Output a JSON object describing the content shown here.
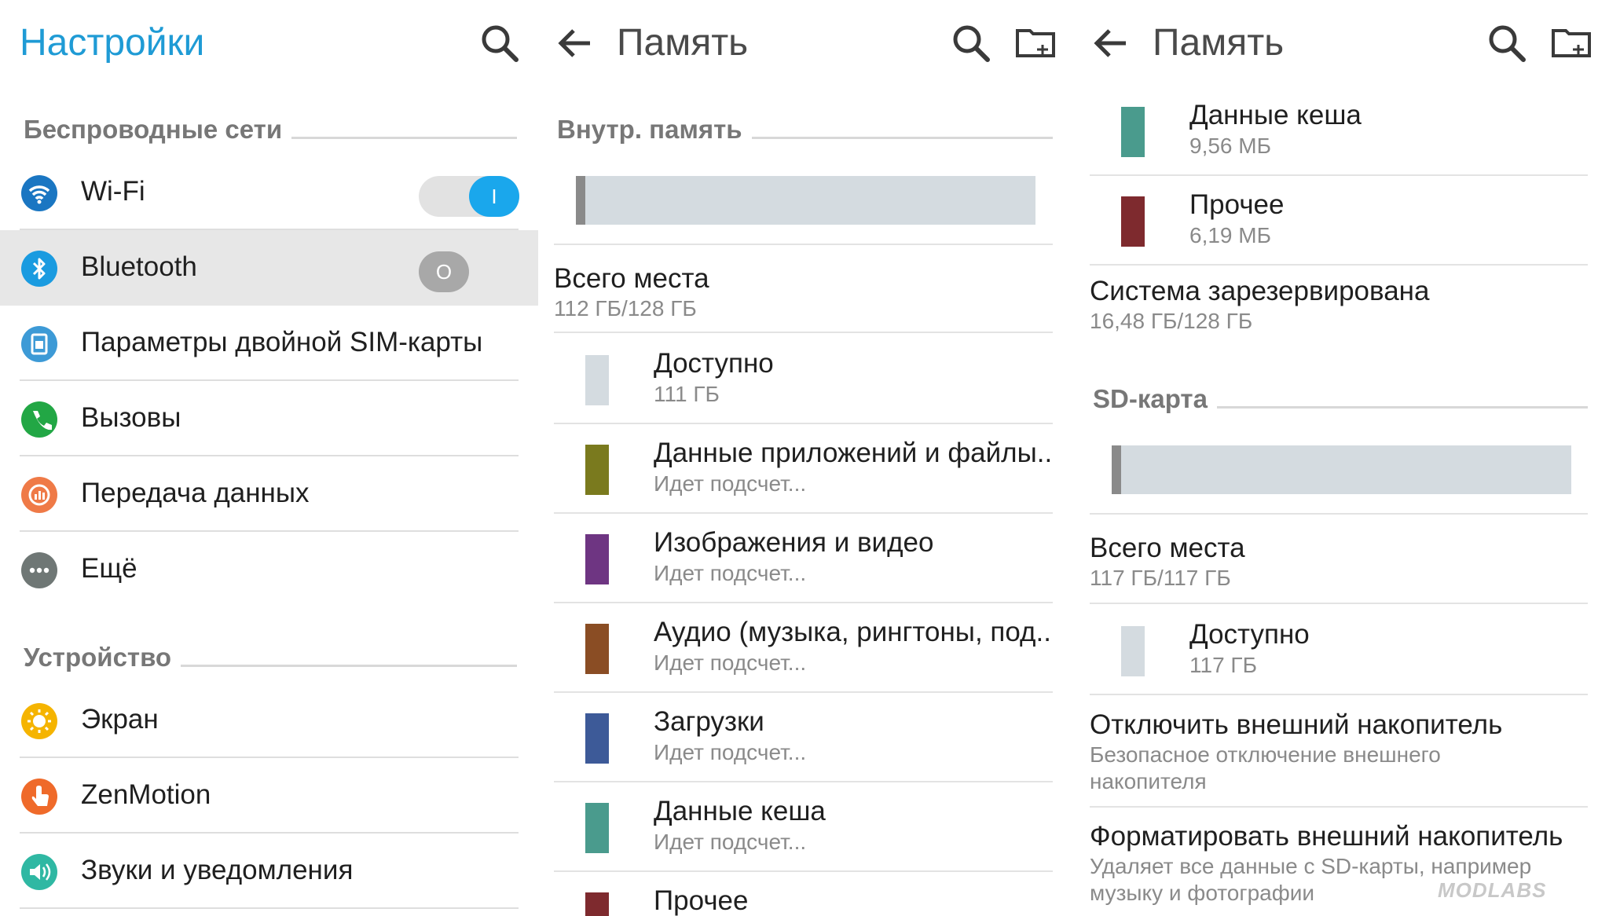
{
  "settings": {
    "title": "Настройки",
    "wireless_header": "Беспроводные сети",
    "wifi": {
      "label": "Wi-Fi",
      "toggle": "I"
    },
    "bluetooth": {
      "label": "Bluetooth",
      "toggle": "O"
    },
    "dualsim": {
      "label": "Параметры двойной SIM-карты"
    },
    "calls": {
      "label": "Вызовы"
    },
    "data": {
      "label": "Передача данных"
    },
    "more": {
      "label": "Ещё"
    },
    "device_header": "Устройство",
    "screen": {
      "label": "Экран"
    },
    "zenmotion": {
      "label": "ZenMotion"
    },
    "sounds": {
      "label": "Звуки и уведомления"
    }
  },
  "memory_internal": {
    "title": "Память",
    "section": "Внутр. память",
    "total": {
      "label": "Всего места",
      "value": "112 ГБ/128 ГБ"
    },
    "items": [
      {
        "label": "Доступно",
        "value": "111 ГБ",
        "color": "#d4dbe0"
      },
      {
        "label": "Данные приложений и файлы..",
        "value": "Идет подсчет...",
        "color": "#7a7a1e"
      },
      {
        "label": "Изображения и видео",
        "value": "Идет подсчет...",
        "color": "#6e3582"
      },
      {
        "label": "Аудио (музыка, рингтоны, под..",
        "value": "Идет подсчет...",
        "color": "#8a4d24"
      },
      {
        "label": "Загрузки",
        "value": "Идет подсчет...",
        "color": "#3d5a98"
      },
      {
        "label": "Данные кеша",
        "value": "Идет подсчет...",
        "color": "#4a9b8d"
      },
      {
        "label": "Прочее",
        "value": "",
        "color": "#7e2a2e"
      }
    ]
  },
  "memory_sd": {
    "title": "Память",
    "cache": {
      "label": "Данные кеша",
      "value": "9,56 МБ",
      "color": "#4a9b8d"
    },
    "other": {
      "label": "Прочее",
      "value": "6,19 МБ",
      "color": "#7e2a2e"
    },
    "system": {
      "label": "Система зарезервирована",
      "value": "16,48 ГБ/128 ГБ"
    },
    "section": "SD-карта",
    "total": {
      "label": "Всего места",
      "value": "117 ГБ/117 ГБ"
    },
    "available": {
      "label": "Доступно",
      "value": "117 ГБ",
      "color": "#d4dbe0"
    },
    "unmount": {
      "label": "Отключить внешний накопитель",
      "desc": "Безопасное отключение внешнего накопителя"
    },
    "format": {
      "label": "Форматировать внешний накопитель",
      "desc": "Удаляет все данные с SD-карты, например музыку и фотографии"
    }
  },
  "watermark": "MODLABS"
}
